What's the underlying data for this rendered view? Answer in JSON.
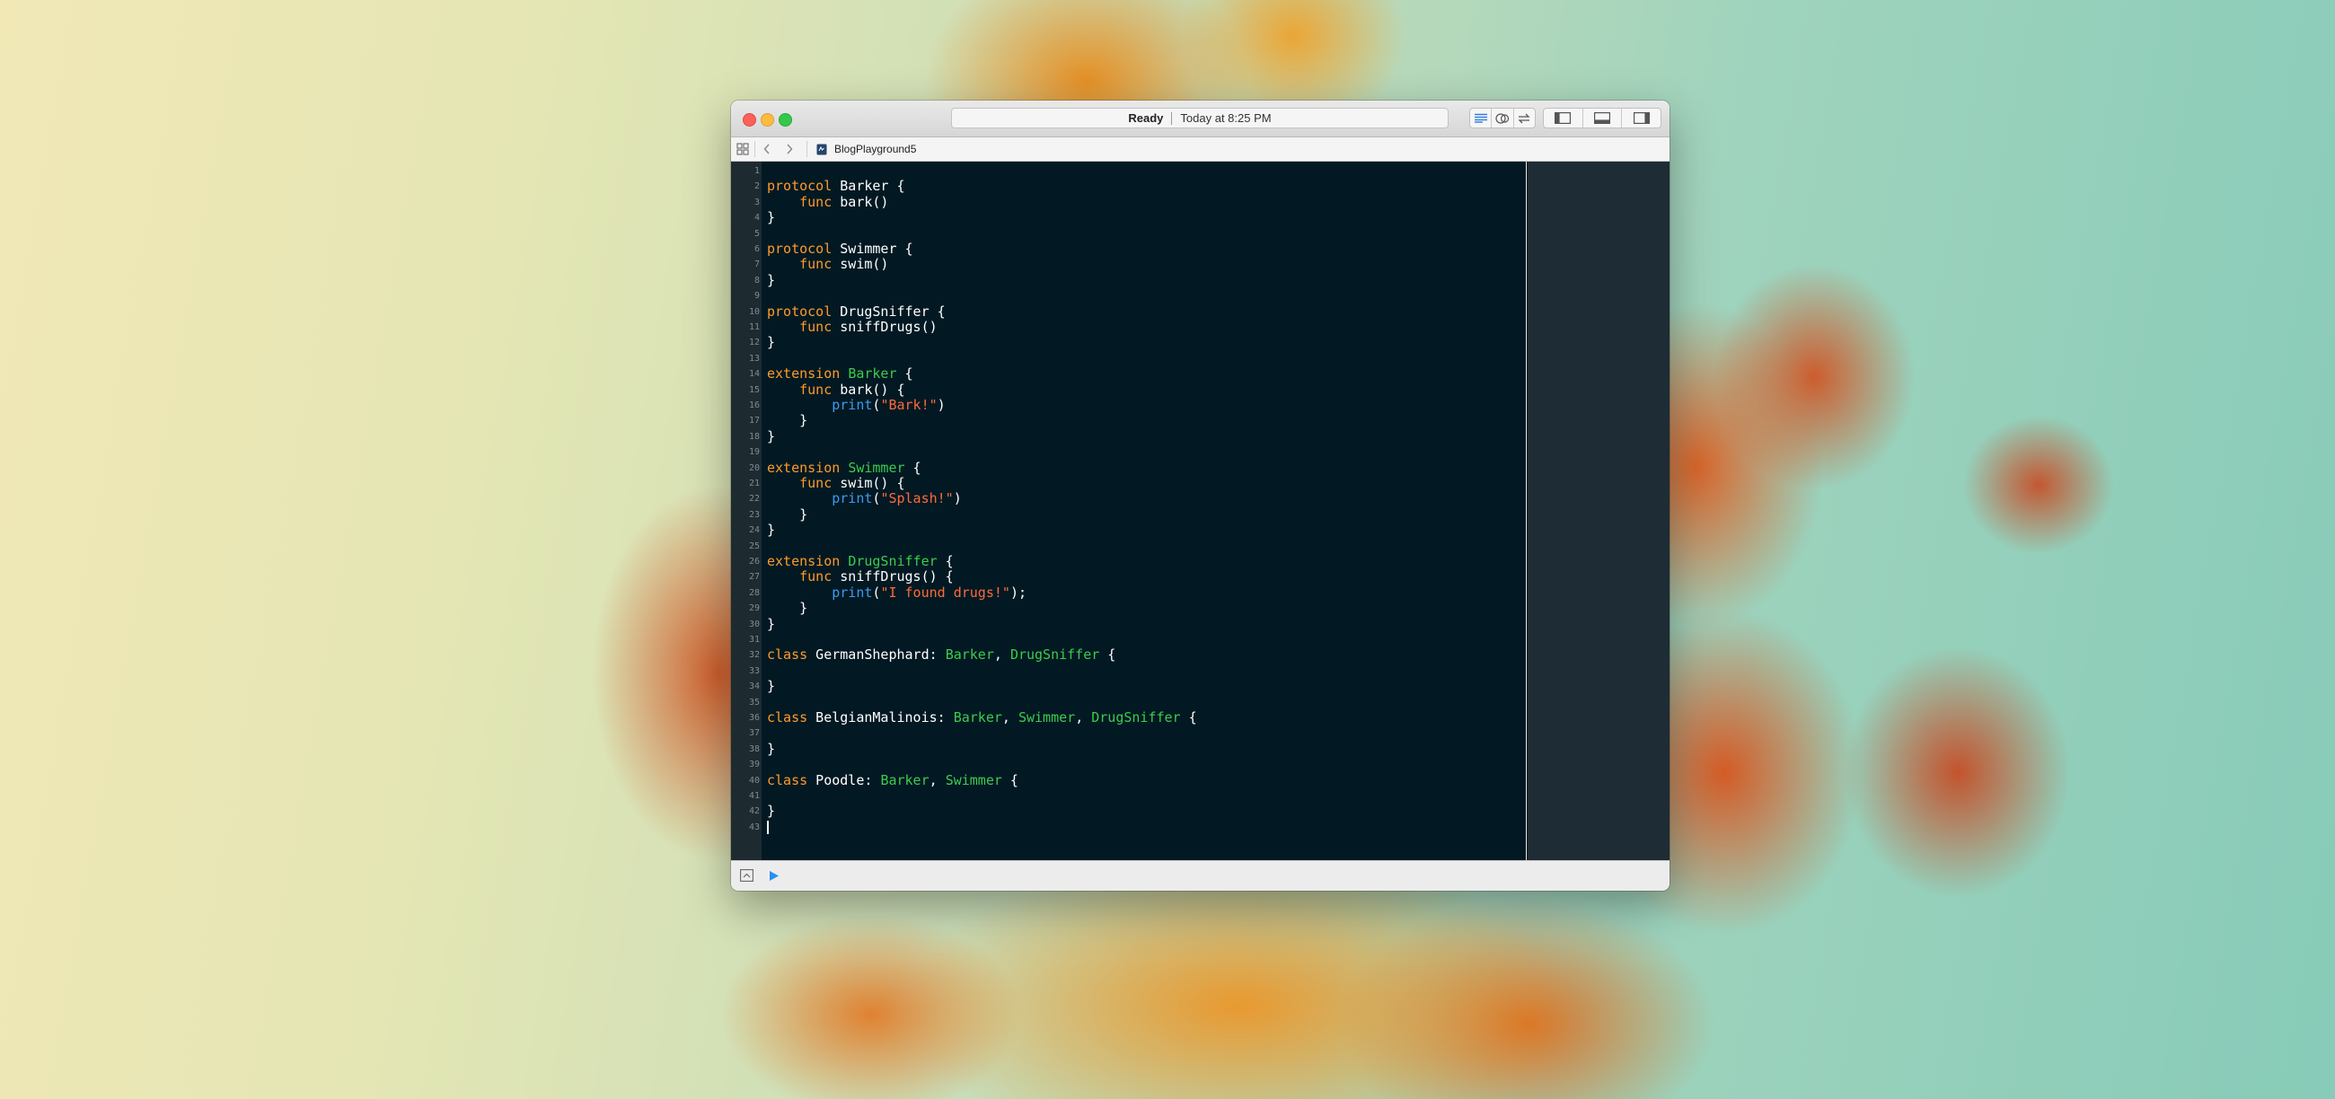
{
  "window": {
    "status": "Ready",
    "timestamp": "Today at 8:25 PM",
    "breadcrumb_file": "BlogPlayground5"
  },
  "toolbar": {
    "editor_mode_icons": [
      "standard-editor-icon",
      "assistant-editor-icon",
      "version-editor-icon"
    ],
    "panel_icons": [
      "navigator-panel-icon",
      "debug-area-icon",
      "utilities-panel-icon"
    ]
  },
  "colors": {
    "keyword": "#fc9b2b",
    "type": "#3ecb4d",
    "function": "#3a9cf3",
    "string": "#fc6a3a",
    "plain": "#ffffff",
    "editor_background": "#021923"
  },
  "code": {
    "lines": [
      [],
      [
        [
          "kw",
          "protocol"
        ],
        [
          "pl",
          " Barker {"
        ]
      ],
      [
        [
          "pl",
          "    "
        ],
        [
          "kw",
          "func"
        ],
        [
          "pl",
          " bark()"
        ]
      ],
      [
        [
          "pl",
          "}"
        ]
      ],
      [],
      [
        [
          "kw",
          "protocol"
        ],
        [
          "pl",
          " Swimmer {"
        ]
      ],
      [
        [
          "pl",
          "    "
        ],
        [
          "kw",
          "func"
        ],
        [
          "pl",
          " swim()"
        ]
      ],
      [
        [
          "pl",
          "}"
        ]
      ],
      [],
      [
        [
          "kw",
          "protocol"
        ],
        [
          "pl",
          " DrugSniffer {"
        ]
      ],
      [
        [
          "pl",
          "    "
        ],
        [
          "kw",
          "func"
        ],
        [
          "pl",
          " sniffDrugs()"
        ]
      ],
      [
        [
          "pl",
          "}"
        ]
      ],
      [],
      [
        [
          "kw",
          "extension"
        ],
        [
          "pl",
          " "
        ],
        [
          "ty",
          "Barker"
        ],
        [
          "pl",
          " {"
        ]
      ],
      [
        [
          "pl",
          "    "
        ],
        [
          "kw",
          "func"
        ],
        [
          "pl",
          " bark() {"
        ]
      ],
      [
        [
          "pl",
          "        "
        ],
        [
          "fn",
          "print"
        ],
        [
          "pl",
          "("
        ],
        [
          "str",
          "\"Bark!\""
        ],
        [
          "pl",
          ")"
        ]
      ],
      [
        [
          "pl",
          "    }"
        ]
      ],
      [
        [
          "pl",
          "}"
        ]
      ],
      [],
      [
        [
          "kw",
          "extension"
        ],
        [
          "pl",
          " "
        ],
        [
          "ty",
          "Swimmer"
        ],
        [
          "pl",
          " {"
        ]
      ],
      [
        [
          "pl",
          "    "
        ],
        [
          "kw",
          "func"
        ],
        [
          "pl",
          " swim() {"
        ]
      ],
      [
        [
          "pl",
          "        "
        ],
        [
          "fn",
          "print"
        ],
        [
          "pl",
          "("
        ],
        [
          "str",
          "\"Splash!\""
        ],
        [
          "pl",
          ")"
        ]
      ],
      [
        [
          "pl",
          "    }"
        ]
      ],
      [
        [
          "pl",
          "}"
        ]
      ],
      [],
      [
        [
          "kw",
          "extension"
        ],
        [
          "pl",
          " "
        ],
        [
          "ty",
          "DrugSniffer"
        ],
        [
          "pl",
          " {"
        ]
      ],
      [
        [
          "pl",
          "    "
        ],
        [
          "kw",
          "func"
        ],
        [
          "pl",
          " sniffDrugs() {"
        ]
      ],
      [
        [
          "pl",
          "        "
        ],
        [
          "fn",
          "print"
        ],
        [
          "pl",
          "("
        ],
        [
          "str",
          "\"I found drugs!\""
        ],
        [
          "pl",
          ");"
        ]
      ],
      [
        [
          "pl",
          "    }"
        ]
      ],
      [
        [
          "pl",
          "}"
        ]
      ],
      [],
      [
        [
          "kw",
          "class"
        ],
        [
          "pl",
          " GermanShephard: "
        ],
        [
          "ty",
          "Barker"
        ],
        [
          "pl",
          ", "
        ],
        [
          "ty",
          "DrugSniffer"
        ],
        [
          "pl",
          " {"
        ]
      ],
      [],
      [
        [
          "pl",
          "}"
        ]
      ],
      [],
      [
        [
          "kw",
          "class"
        ],
        [
          "pl",
          " BelgianMalinois: "
        ],
        [
          "ty",
          "Barker"
        ],
        [
          "pl",
          ", "
        ],
        [
          "ty",
          "Swimmer"
        ],
        [
          "pl",
          ", "
        ],
        [
          "ty",
          "DrugSniffer"
        ],
        [
          "pl",
          " {"
        ]
      ],
      [],
      [
        [
          "pl",
          "}"
        ]
      ],
      [],
      [
        [
          "kw",
          "class"
        ],
        [
          "pl",
          " Poodle: "
        ],
        [
          "ty",
          "Barker"
        ],
        [
          "pl",
          ", "
        ],
        [
          "ty",
          "Swimmer"
        ],
        [
          "pl",
          " {"
        ]
      ],
      [],
      [
        [
          "pl",
          "}"
        ]
      ],
      []
    ],
    "caret_line": 43
  }
}
